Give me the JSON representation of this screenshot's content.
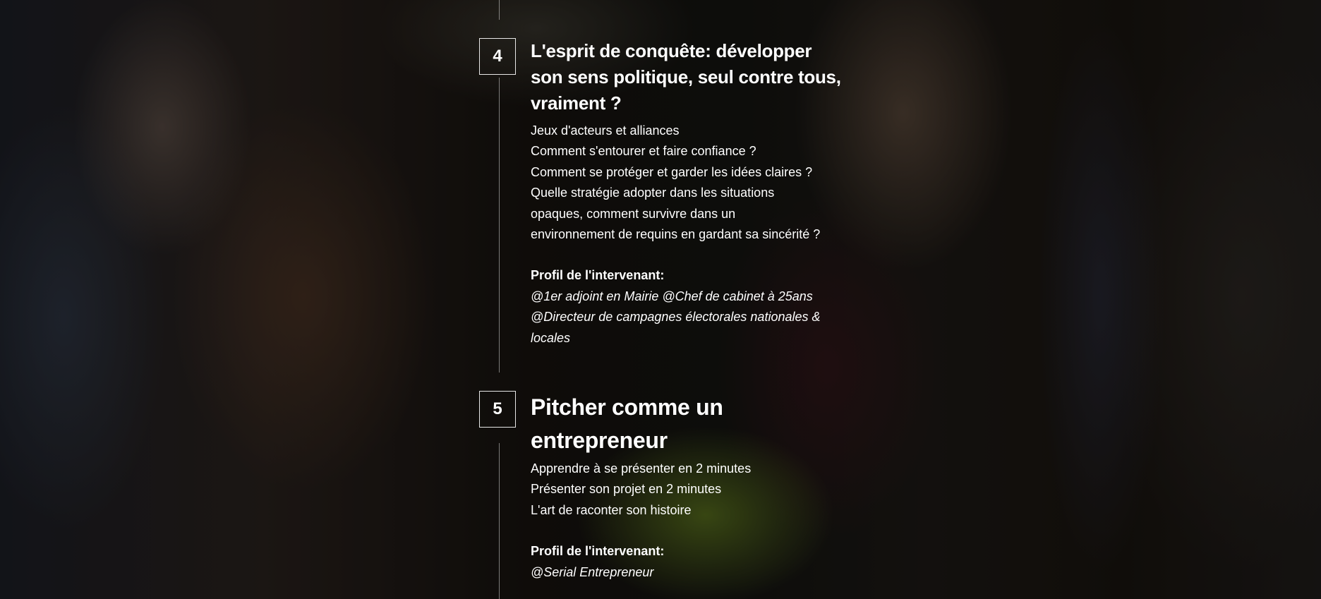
{
  "modules": [
    {
      "number": "4",
      "title_lines": [
        "L'esprit de conquête: développer",
        "son sens politique, seul contre tous,",
        "vraiment ?"
      ],
      "items": [
        "Jeux d'acteurs et alliances",
        "Comment s'entourer et faire confiance ?",
        "Comment se protéger et garder les idées claires ?",
        "Quelle stratégie adopter dans les situations",
        "opaques, comment survivre dans un",
        "environnement de requins en gardant sa sincérité ?"
      ],
      "profile_label": "Profil de l'intervenant:",
      "profile_lines": [
        "@1er adjoint en Mairie @Chef de cabinet à 25ans",
        "@Directeur de campagnes électorales nationales &",
        "locales"
      ]
    },
    {
      "number": "5",
      "title_lines": [
        "Pitcher comme un",
        "entrepreneur"
      ],
      "items": [
        "Apprendre à se présenter en 2 minutes",
        "Présenter son projet en 2 minutes",
        "L'art de raconter son histoire"
      ],
      "profile_label": "Profil de l'intervenant:",
      "profile_lines": [
        "@Serial Entrepreneur"
      ]
    }
  ]
}
